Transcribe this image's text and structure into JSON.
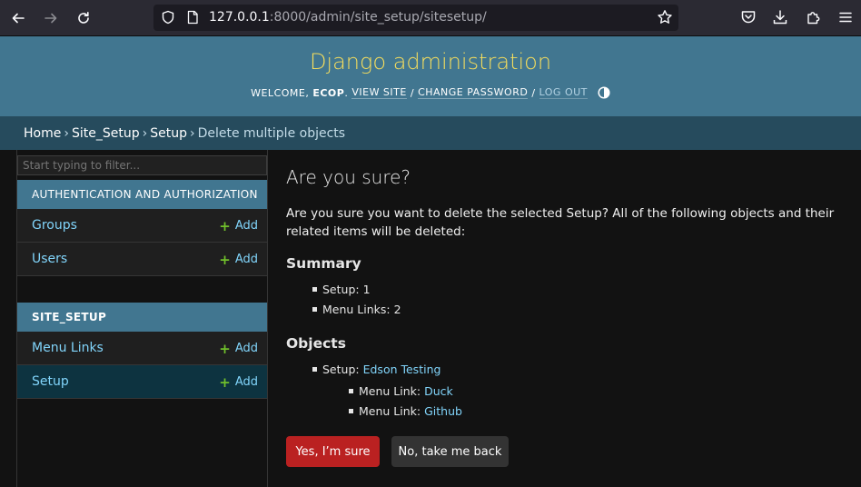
{
  "browser": {
    "url_host": "127.0.0.1",
    "url_rest": ":8000/admin/site_setup/sitesetup/"
  },
  "header": {
    "branding": "Django administration",
    "welcome": "WELCOME,",
    "username": "ECOP",
    "view_site": "VIEW SITE",
    "change_password": "CHANGE PASSWORD",
    "log_out": "LOG OUT",
    "separator": "/"
  },
  "breadcrumbs": {
    "items": [
      "Home",
      "Site_Setup",
      "Setup"
    ],
    "current": "Delete multiple objects",
    "arrow": "›"
  },
  "sidebar": {
    "filter_placeholder": "Start typing to filter...",
    "modules": [
      {
        "caption": "AUTHENTICATION AND AUTHORIZATION",
        "rows": [
          {
            "label": "Groups",
            "add": "Add"
          },
          {
            "label": "Users",
            "add": "Add"
          }
        ]
      },
      {
        "caption": "SITE_SETUP",
        "rows": [
          {
            "label": "Menu Links",
            "add": "Add"
          },
          {
            "label": "Setup",
            "add": "Add"
          }
        ]
      }
    ]
  },
  "content": {
    "title": "Are you sure?",
    "intro": "Are you sure you want to delete the selected Setup? All of the following objects and their related items will be deleted:",
    "summary_heading": "Summary",
    "summary": [
      "Setup: 1",
      "Menu Links: 2"
    ],
    "objects_heading": "Objects",
    "objects": {
      "setup_prefix": "Setup:",
      "setup_name": "Edson Testing",
      "menu_prefix": "Menu Link:",
      "menu_links": [
        "Duck",
        "Github"
      ]
    },
    "confirm_button": "Yes, I’m sure",
    "cancel_button": "No, take me back"
  },
  "colors": {
    "header_bg": "#417690",
    "branding": "#f5dd5d",
    "breadcrumbs_bg": "#264b5d",
    "link": "#81d4fa",
    "danger": "#ba2121",
    "add_icon": "#70bf2b"
  }
}
